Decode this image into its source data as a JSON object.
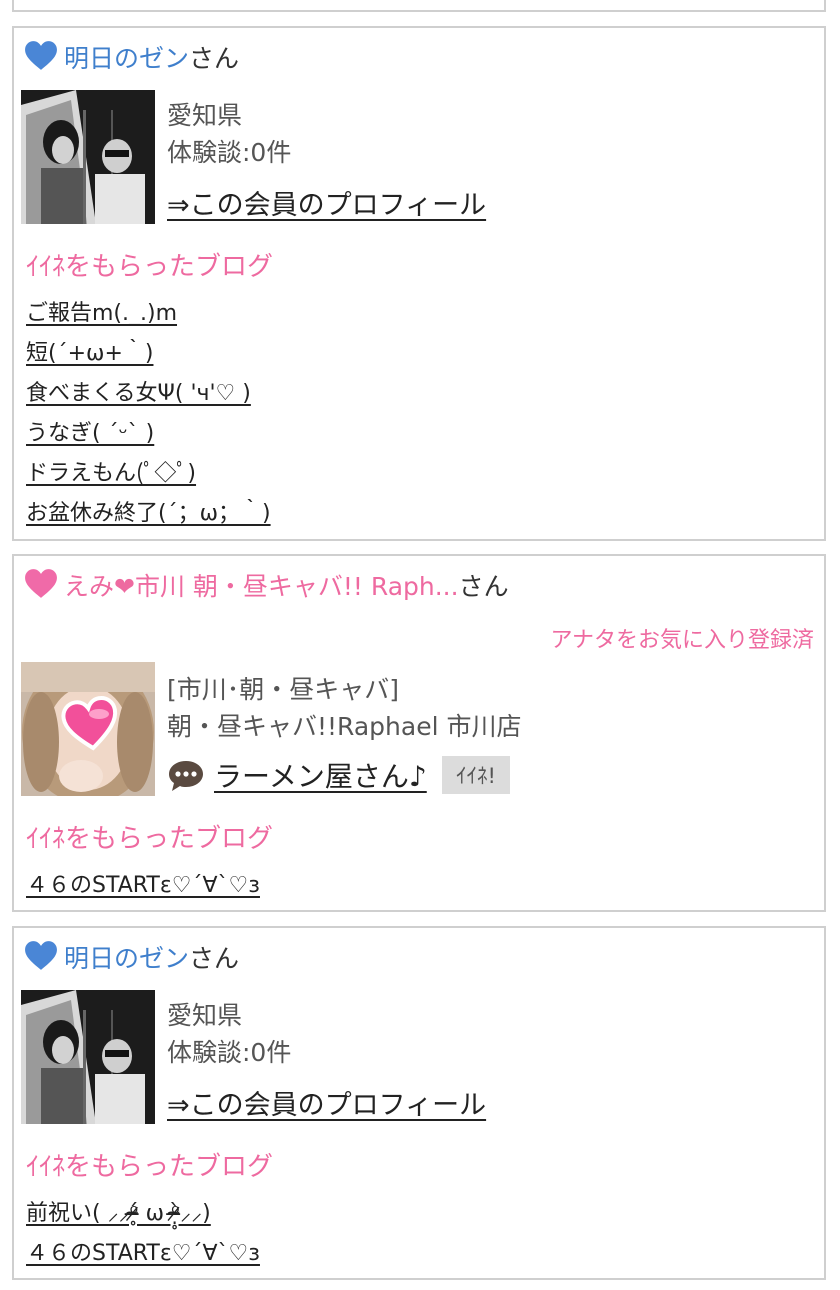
{
  "cards": [
    {
      "name": "明日のゼン",
      "honorific": "さん",
      "prefecture": "愛知県",
      "reviews": "体験談:0件",
      "profile_link": "⇒この会員のプロフィール",
      "section_title": "ｲｲﾈをもらったブログ",
      "blogs": [
        "ご報告m(._.)m",
        "短(´+ω+｀)",
        "食べまくる女Ψ( 'ч'♡ )",
        "うなぎ( ´ᵕ` )",
        "ドラえもん(ﾟ◇ﾟ)",
        "お盆休み終了(´；ω；｀)"
      ]
    },
    {
      "name": "えみ❤市川 朝・昼キャバ!! Raph...",
      "honorific": "さん",
      "favorite": "アナタをお気に入り登録済",
      "tag": "[市川･朝・昼キャバ]",
      "shop": "朝・昼キャバ!!Raphael 市川店",
      "post": "ラーメン屋さん♪",
      "iine": "ｲｲﾈ!",
      "section_title": "ｲｲﾈをもらったブログ",
      "blogs": [
        "４６のSTARTε♡´∀`♡з"
      ]
    },
    {
      "name": "明日のゼン",
      "honorific": "さん",
      "prefecture": "愛知県",
      "reviews": "体験談:0件",
      "profile_link": "⇒この会員のプロフィール",
      "section_title": "ｲｲﾈをもらったブログ",
      "blogs": [
        "前祝い( ⸝⸝ᵒ̴̶̷̥́ ω ᵒ̴̶̷̣̥̀⸝⸝)",
        "４６のSTARTε♡´∀`♡з"
      ]
    }
  ],
  "colors": {
    "blue_heart": "#4a86d6",
    "pink_heart": "#f06aa8",
    "accent_pink": "#ee6aa0",
    "name_blue": "#3f7fcc",
    "border": "#cfcfcf",
    "iine_bg": "#dcdcdc"
  },
  "icons": {
    "member_heart": "blue-heart-icon",
    "cast_heart": "pink-heart-icon",
    "comment": "speech-bubble-icon"
  }
}
